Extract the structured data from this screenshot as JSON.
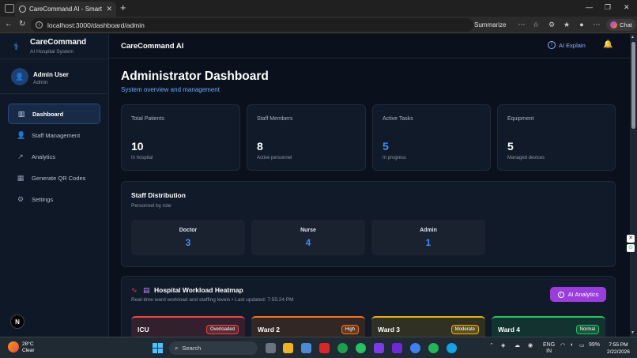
{
  "browser": {
    "tab_title": "CareCommand AI - Smart Digital I",
    "url": "localhost:3000/dashboard/admin",
    "summarize_label": "Summarize",
    "copilot_label": "Chat"
  },
  "sidebar": {
    "brand_name": "CareCommand",
    "brand_subtitle": "AI Hospital System",
    "user_name": "Admin User",
    "user_role": "Admin",
    "items": [
      {
        "label": "Dashboard",
        "icon": "chart-icon",
        "active": true
      },
      {
        "label": "Staff Management",
        "icon": "user-icon",
        "active": false
      },
      {
        "label": "Analytics",
        "icon": "trend-icon",
        "active": false
      },
      {
        "label": "Generate QR Codes",
        "icon": "qr-icon",
        "active": false
      },
      {
        "label": "Settings",
        "icon": "gear-icon",
        "active": false
      }
    ],
    "logo_letter": "N"
  },
  "header": {
    "title": "CareCommand AI",
    "ai_explain_label": "AI Explain"
  },
  "page": {
    "title": "Administrator Dashboard",
    "subtitle": "System overview and management"
  },
  "stats": [
    {
      "label": "Total Patients",
      "value": "10",
      "desc": "In hospital"
    },
    {
      "label": "Staff Members",
      "value": "8",
      "desc": "Active personnel"
    },
    {
      "label": "Active Tasks",
      "value": "5",
      "desc": "In progress"
    },
    {
      "label": "Equipment",
      "value": "5",
      "desc": "Managed devices"
    }
  ],
  "staff_distribution": {
    "title": "Staff Distribution",
    "subtitle": "Personnel by role",
    "roles": [
      {
        "label": "Doctor",
        "value": "3"
      },
      {
        "label": "Nurse",
        "value": "4"
      },
      {
        "label": "Admin",
        "value": "1"
      }
    ]
  },
  "heatmap": {
    "title": "Hospital Workload Heatmap",
    "subtitle": "Real-time ward workload and staffing levels • Last updated: 7:55:24 PM",
    "ai_button_label": "AI Analytics",
    "wards": [
      {
        "name": "ICU",
        "status": "Overloaded",
        "color": "#ef4444"
      },
      {
        "name": "Ward 2",
        "status": "High",
        "color": "#f97316"
      },
      {
        "name": "Ward 3",
        "status": "Moderate",
        "color": "#eab308"
      },
      {
        "name": "Ward 4",
        "status": "Normal",
        "color": "#22c55e"
      }
    ]
  },
  "taskbar": {
    "temperature": "28°C",
    "weather": "Clear",
    "search_placeholder": "Search",
    "lang_1": "ENG",
    "lang_2": "IN",
    "battery": "99%",
    "time": "7:55 PM",
    "date": "2/22/2026"
  }
}
